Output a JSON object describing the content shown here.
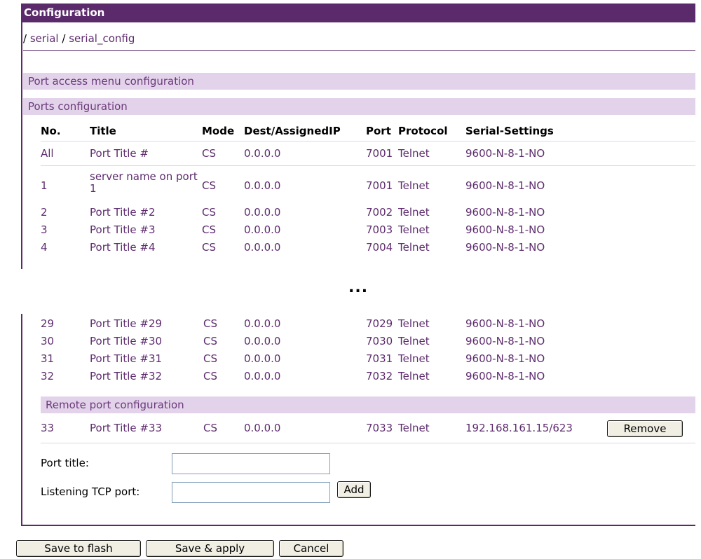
{
  "header": {
    "title": "Configuration"
  },
  "breadcrumb": {
    "sep1": "/",
    "part1": "serial",
    "sep2": "/",
    "part2": "serial_config"
  },
  "sections": {
    "port_access": "Port access menu configuration",
    "ports": "Ports configuration",
    "remote": "Remote port configuration"
  },
  "table": {
    "headers": [
      "No.",
      "Title",
      "Mode",
      "Dest/AssignedIP",
      "Port",
      "Protocol",
      "Serial-Settings"
    ],
    "rows_top": [
      [
        "All",
        "Port Title #",
        "CS",
        "0.0.0.0",
        "7001",
        "Telnet",
        "9600-N-8-1-NO"
      ],
      [
        "1",
        "server name on port 1",
        "CS",
        "0.0.0.0",
        "7001",
        "Telnet",
        "9600-N-8-1-NO"
      ],
      [
        "2",
        "Port Title #2",
        "CS",
        "0.0.0.0",
        "7002",
        "Telnet",
        "9600-N-8-1-NO"
      ],
      [
        "3",
        "Port Title #3",
        "CS",
        "0.0.0.0",
        "7003",
        "Telnet",
        "9600-N-8-1-NO"
      ],
      [
        "4",
        "Port Title #4",
        "CS",
        "0.0.0.0",
        "7004",
        "Telnet",
        "9600-N-8-1-NO"
      ]
    ],
    "ellipsis": "...",
    "rows_bottom": [
      [
        "29",
        "Port Title #29",
        "CS",
        "0.0.0.0",
        "7029",
        "Telnet",
        "9600-N-8-1-NO"
      ],
      [
        "30",
        "Port Title #30",
        "CS",
        "0.0.0.0",
        "7030",
        "Telnet",
        "9600-N-8-1-NO"
      ],
      [
        "31",
        "Port Title #31",
        "CS",
        "0.0.0.0",
        "7031",
        "Telnet",
        "9600-N-8-1-NO"
      ],
      [
        "32",
        "Port Title #32",
        "CS",
        "0.0.0.0",
        "7032",
        "Telnet",
        "9600-N-8-1-NO"
      ]
    ],
    "remote_row": [
      "33",
      "Port Title #33",
      "CS",
      "0.0.0.0",
      "7033",
      "Telnet",
      "192.168.161.15/623"
    ]
  },
  "buttons": {
    "remove": "Remove",
    "add": "Add",
    "save_flash": "Save to flash",
    "save_apply": "Save & apply",
    "cancel": "Cancel"
  },
  "form": {
    "port_title_label": "Port title:",
    "port_title_value": "",
    "listening_label": "Listening TCP port:",
    "listening_value": ""
  },
  "colors": {
    "header_bg": "#5b2a6b",
    "section_bg": "#e3d3ea",
    "text": "#5e2c6e"
  }
}
